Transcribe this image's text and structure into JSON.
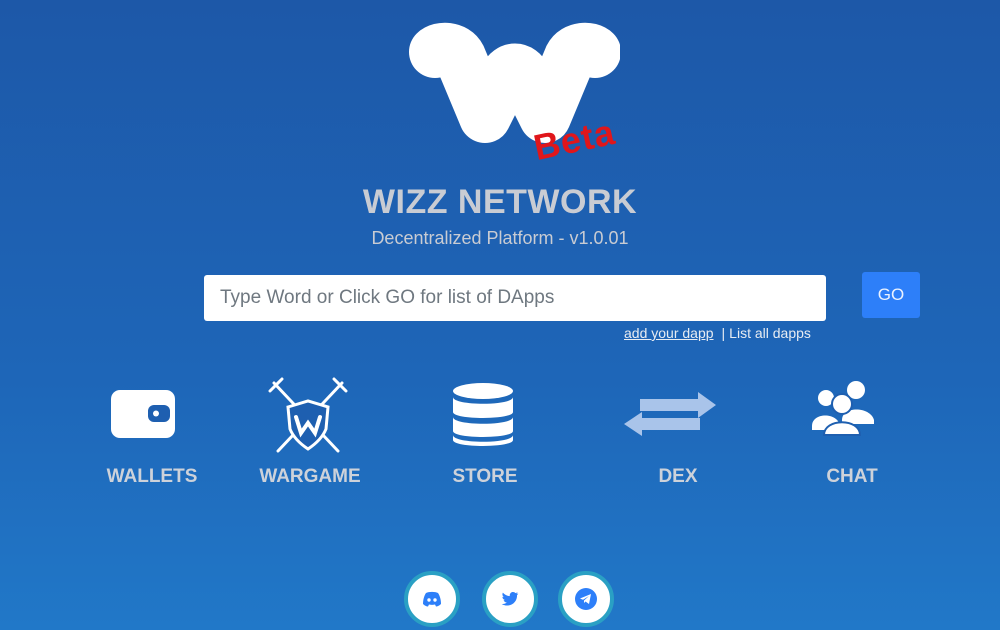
{
  "brand": {
    "title": "WIZZ NETWORK",
    "subtitle": "Decentralized Platform - v1.0.01",
    "beta_label": "Beta",
    "logo_icon": "wizz-w-logo"
  },
  "search": {
    "placeholder": "Type Word or Click GO for list of DApps",
    "value": "",
    "go_label": "GO"
  },
  "links": {
    "add_dapp": "add your dapp",
    "separator": "|",
    "list_all": "List all dapps"
  },
  "nav": {
    "wallets": {
      "label": "WALLETS",
      "icon": "wallet-icon"
    },
    "wargame": {
      "label": "WARGAME",
      "icon": "crossed-swords-shield-icon"
    },
    "store": {
      "label": "STORE",
      "icon": "database-icon"
    },
    "dex": {
      "label": "DEX",
      "icon": "exchange-arrows-icon"
    },
    "chat": {
      "label": "CHAT",
      "icon": "users-icon"
    }
  },
  "social": [
    {
      "name": "discord",
      "icon": "discord-icon"
    },
    {
      "name": "twitter",
      "icon": "twitter-icon"
    },
    {
      "name": "telegram",
      "icon": "telegram-icon"
    }
  ],
  "colors": {
    "background": "#1e5fb0",
    "accent": "#2d7ff9",
    "beta": "#e0161b",
    "social_ring": "#2aa0c4"
  }
}
